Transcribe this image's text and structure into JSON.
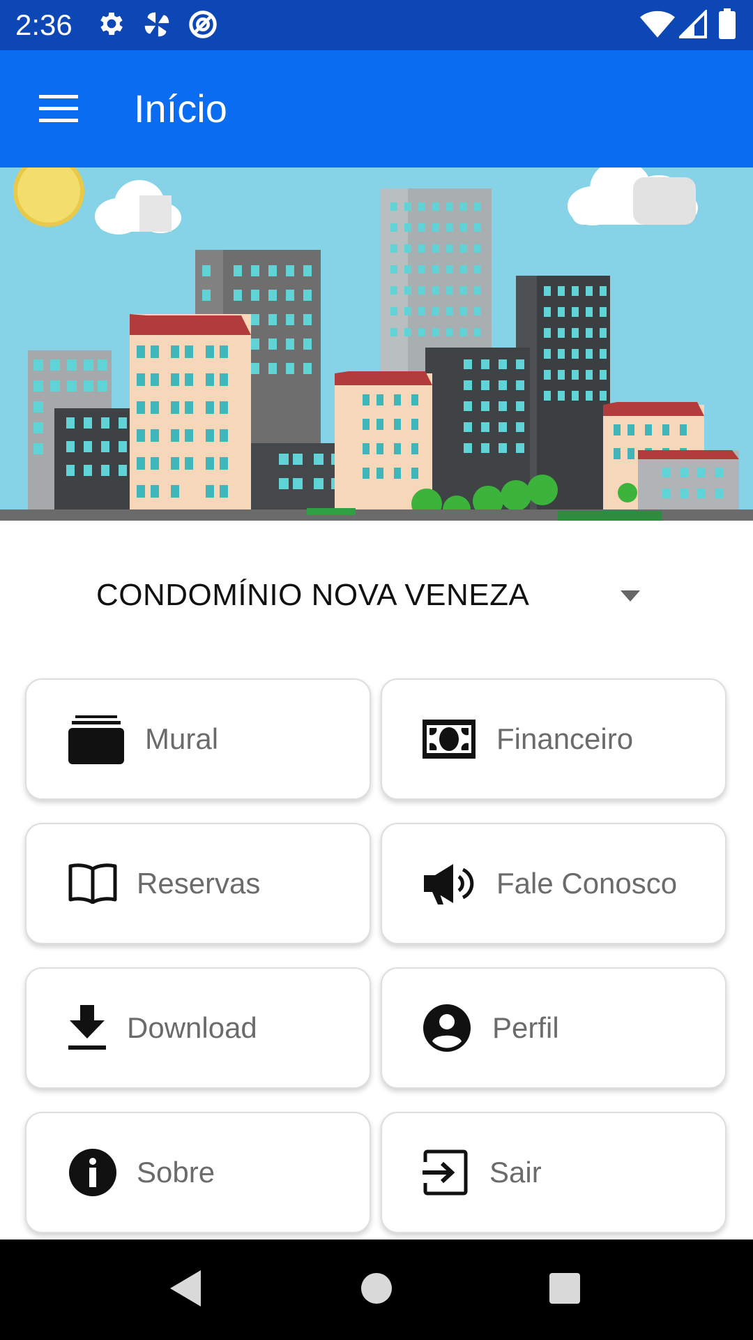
{
  "status_bar": {
    "time": "2:36",
    "icons_left": [
      "gear-icon",
      "pinwheel-icon",
      "at-sign-icon"
    ],
    "icons_right": [
      "wifi-icon",
      "signal-icon",
      "battery-icon"
    ]
  },
  "app_bar": {
    "title": "Início",
    "menu_icon": "hamburger-menu-icon",
    "color": "#0a6cf0"
  },
  "condo_select": {
    "selected": "CONDOMÍNIO NOVA VENEZA"
  },
  "menu": [
    {
      "label": "Mural",
      "icon": "cards-stack-icon"
    },
    {
      "label": "Financeiro",
      "icon": "money-bill-icon"
    },
    {
      "label": "Reservas",
      "icon": "open-book-icon"
    },
    {
      "label": "Fale Conosco",
      "icon": "megaphone-icon"
    },
    {
      "label": "Download",
      "icon": "download-icon"
    },
    {
      "label": "Perfil",
      "icon": "account-circle-icon"
    },
    {
      "label": "Sobre",
      "icon": "info-icon"
    },
    {
      "label": "Sair",
      "icon": "exit-icon"
    }
  ],
  "nav_bar": {
    "buttons": [
      "back-icon",
      "home-icon",
      "recents-icon"
    ]
  }
}
